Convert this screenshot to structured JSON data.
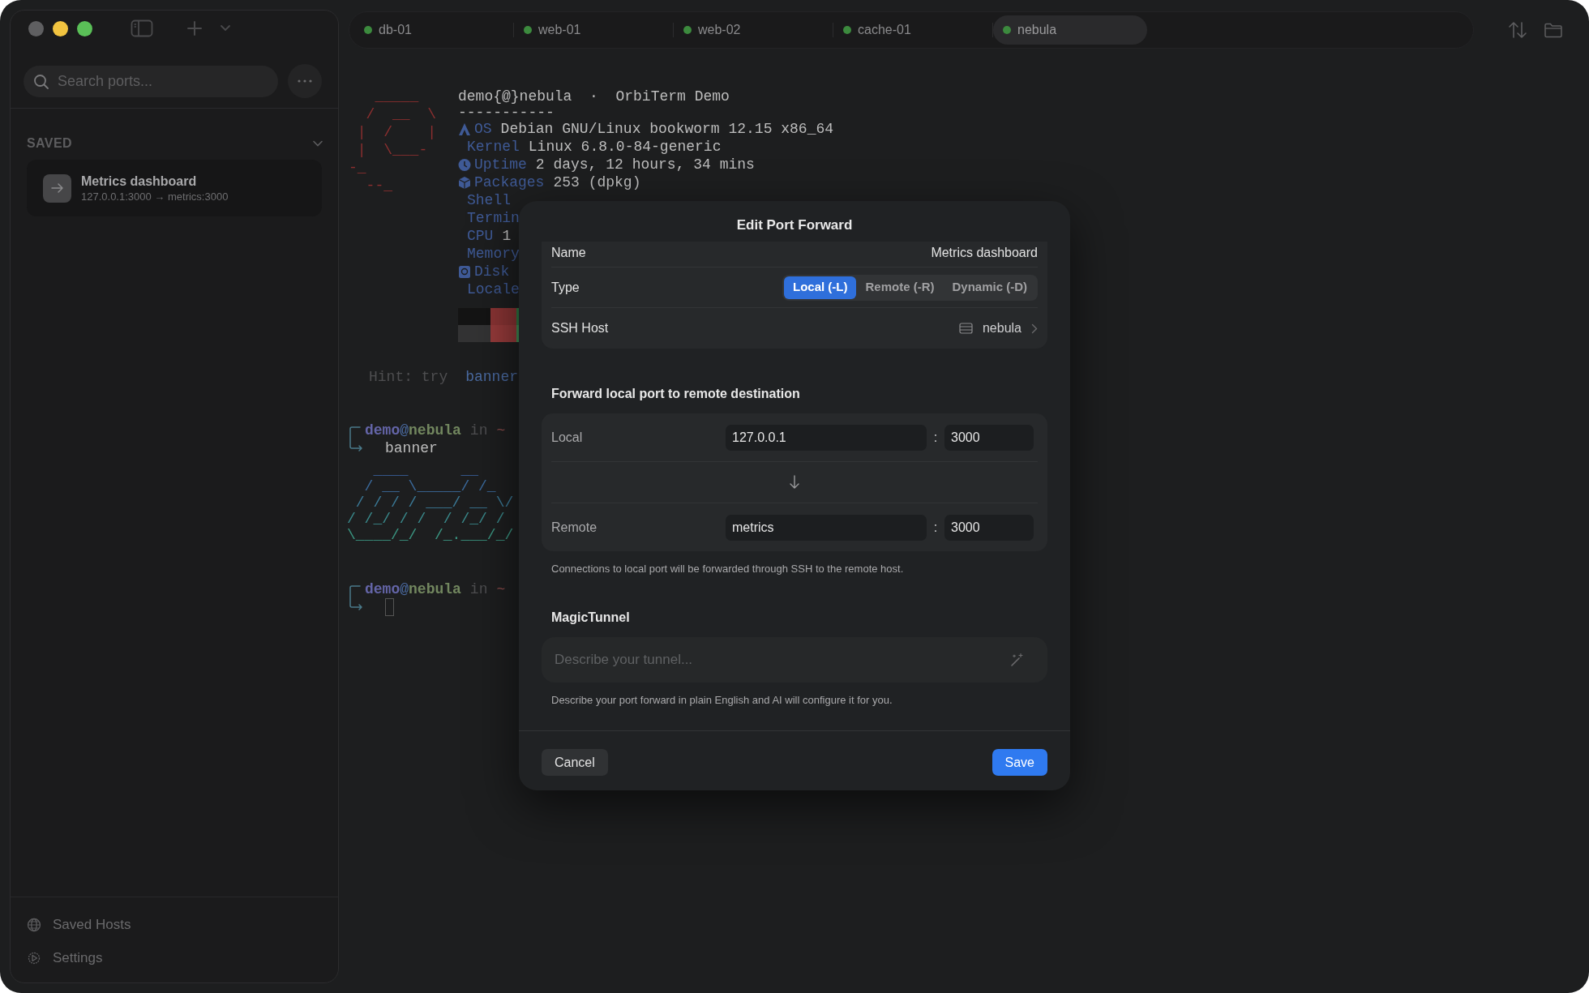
{
  "sidebar": {
    "search": {
      "placeholder": "Search ports..."
    },
    "sections": [
      {
        "label": "SAVED",
        "expanded": true,
        "items": [
          {
            "title": "Metrics dashboard",
            "subtitle": "127.0.0.1:3000 → metrics:3000"
          }
        ]
      }
    ],
    "footer": [
      {
        "label": "Saved Hosts"
      },
      {
        "label": "Settings"
      }
    ]
  },
  "tabs": [
    {
      "label": "db-01",
      "selected": false
    },
    {
      "label": "web-01",
      "selected": false
    },
    {
      "label": "web-02",
      "selected": false
    },
    {
      "label": "cache-01",
      "selected": false
    },
    {
      "label": "nebula",
      "selected": true
    }
  ],
  "terminal": {
    "logo_art": [
      "   _____",
      "  /  __  \\",
      " |  /    |",
      " |  \\___-",
      "-_",
      "  --_"
    ],
    "header": "demo{@}nebula  ·  OrbiTerm Demo",
    "rule": "-----------",
    "info": [
      {
        "key": "OS",
        "value": "Debian GNU/Linux bookworm 12.15 x86_64"
      },
      {
        "key": "Kernel",
        "value": "Linux 6.8.0-84-generic"
      },
      {
        "key": "Uptime",
        "value": "2 days, 12 hours, 34 mins"
      },
      {
        "key": "Packages",
        "value": "253 (dpkg)"
      },
      {
        "key": "Shell"
      },
      {
        "key": "Termin"
      },
      {
        "key": "CPU",
        "value": "1"
      },
      {
        "key": "Memory"
      },
      {
        "key": "Disk"
      },
      {
        "key": "Locale"
      }
    ],
    "hint": {
      "text": "Hint: try",
      "command": "banner"
    },
    "sessions": [
      {
        "user": "demo",
        "at": "@",
        "host": "nebula",
        "where": "in",
        "dir": "~",
        "command": "banner",
        "output": [
          "   ____      __",
          "  / __ \\_____/ /_",
          " / / / / ___/ __ \\/",
          "/ /_/ / /  / /_/ /",
          "\\____/_/  /_.___/_/"
        ]
      },
      {
        "user": "demo",
        "at": "@",
        "host": "nebula",
        "where": "in",
        "dir": "~",
        "cursor": true
      }
    ]
  },
  "dialog": {
    "title": "Edit Port Forward",
    "fields": [
      {
        "kind": "text",
        "label": "Name",
        "value": "Metrics dashboard"
      },
      {
        "kind": "segmented",
        "label": "Type",
        "options": [
          {
            "label": "Local (-L)",
            "selected": true
          },
          {
            "label": "Remote (-R)",
            "selected": false
          },
          {
            "label": "Dynamic (-D)",
            "selected": false
          }
        ]
      },
      {
        "kind": "link",
        "label": "SSH Host",
        "value": "nebula"
      }
    ],
    "forward": {
      "heading": "Forward local port to remote destination",
      "endpoints": [
        {
          "label": "Local",
          "host": "127.0.0.1",
          "separator": ":",
          "port": "3000"
        },
        {
          "label": "Remote",
          "host": "metrics",
          "separator": ":",
          "port": "3000"
        }
      ],
      "note": "Connections to local port will be forwarded through SSH to the remote host."
    },
    "magic": {
      "heading": "MagicTunnel",
      "placeholder": "Describe your tunnel...",
      "note": "Describe your port forward in plain English and AI will configure it for you."
    },
    "buttons": [
      {
        "label": "Cancel",
        "kind": "secondary"
      },
      {
        "label": "Save",
        "kind": "primary"
      }
    ]
  }
}
